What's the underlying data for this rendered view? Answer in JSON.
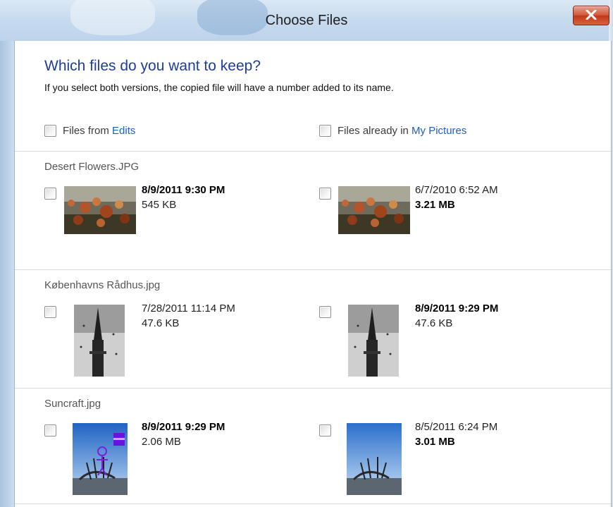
{
  "window": {
    "title": "Choose Files"
  },
  "header": {
    "question": "Which files do you want to keep?",
    "instruction": "If you select both versions, the copied file will have a number added to its name."
  },
  "sources": {
    "left": {
      "prefix": "Files from ",
      "link": "Edits"
    },
    "right": {
      "prefix": "Files already in ",
      "link": "My Pictures"
    }
  },
  "files": [
    {
      "name": "Desert Flowers.JPG",
      "left": {
        "date": "8/9/2011 9:30 PM",
        "size": "545 KB",
        "date_bold": true,
        "size_bold": false
      },
      "right": {
        "date": "6/7/2010 6:52 AM",
        "size": "3.21 MB",
        "date_bold": false,
        "size_bold": true
      }
    },
    {
      "name": "Københavns Rådhus.jpg",
      "left": {
        "date": "7/28/2011 11:14 PM",
        "size": "47.6 KB",
        "date_bold": false,
        "size_bold": false
      },
      "right": {
        "date": "8/9/2011 9:29 PM",
        "size": "47.6 KB",
        "date_bold": true,
        "size_bold": false
      }
    },
    {
      "name": "Suncraft.jpg",
      "left": {
        "date": "8/9/2011 9:29 PM",
        "size": "2.06 MB",
        "date_bold": true,
        "size_bold": false
      },
      "right": {
        "date": "8/5/2011 6:24 PM",
        "size": "3.01 MB",
        "date_bold": false,
        "size_bold": true
      }
    }
  ],
  "icons": {
    "close": "close-icon",
    "checkbox": "checkbox-icon"
  },
  "colors": {
    "heading": "#1e3d9c",
    "link": "#1e5fc7",
    "close": "#c2381a"
  }
}
